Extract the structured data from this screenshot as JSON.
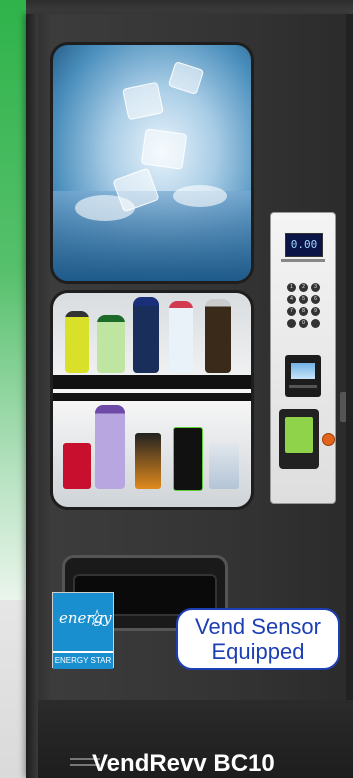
{
  "controls": {
    "price_display": "0.00",
    "keypad": [
      "1",
      "2",
      "3",
      "4",
      "5",
      "6",
      "7",
      "8",
      "9",
      "",
      "0",
      ""
    ]
  },
  "badges": {
    "energy_script": "energy",
    "energy_label": "ENERGY STAR",
    "vend_sensor_line1": "Vend Sensor",
    "vend_sensor_line2": "Equipped"
  },
  "product": {
    "model_name": "VendRevv BC10"
  },
  "colors": {
    "background_green": "#2fb34a",
    "machine_body": "#343434",
    "energy_star_blue": "#1a8fd0",
    "badge_text_blue": "#1c3fb3",
    "coin_return_orange": "#e3631a",
    "card_reader_screen": "#8ed34a"
  }
}
